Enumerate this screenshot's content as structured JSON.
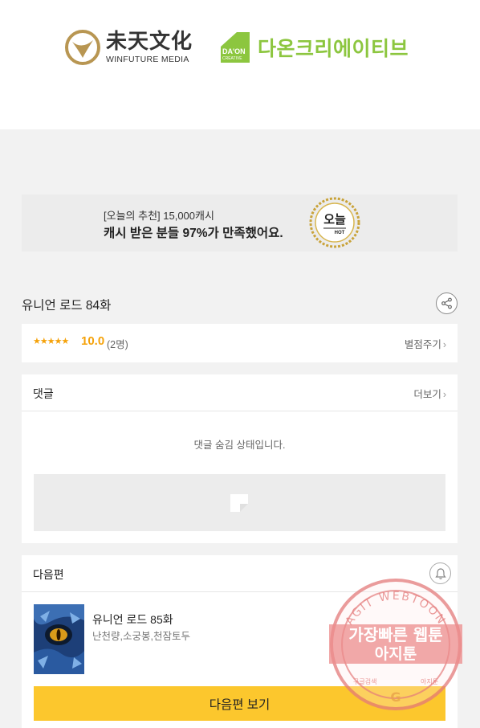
{
  "publishers": {
    "left": {
      "name_cn": "未天文化",
      "name_en": "WINFUTURE MEDIA"
    },
    "right": {
      "box_line1": "DA'ON",
      "box_line2": "CREATIVE",
      "name": "다온크리에이티브"
    }
  },
  "ad": {
    "line1": "[오늘의 추천] 15,000캐시",
    "line2": "캐시 받은 분들 97%가 만족했어요.",
    "badge_text": "오늘",
    "badge_sub": "HOT"
  },
  "episode": {
    "title": "유니언 로드 84화",
    "share_icon": "share-icon"
  },
  "rating": {
    "stars": "★★★★★",
    "score": "10.0",
    "count": "(2명)",
    "rate_label": "별점주기",
    "chevron": "›"
  },
  "comments": {
    "header": "댓글",
    "more_label": "더보기",
    "chevron": "›",
    "hidden_message": "댓글 숨김 상태입니다."
  },
  "next_episode": {
    "header": "다음편",
    "bell_icon": "bell-icon",
    "title": "유니언 로드 85화",
    "authors": "난천량,소궁봉,천잠토두",
    "button_label": "다음편 보기"
  },
  "watermark": {
    "ring_text": "AGIT WEBTOON",
    "line1": "가장빠른 웹툰",
    "line2": "아지툰",
    "bottom_left": "구글검색",
    "bottom_right": "아지툰",
    "center_mark": "G"
  },
  "colors": {
    "accent_yellow": "#fcc72d",
    "star_orange": "#f5a20a",
    "daon_green": "#8cc63f",
    "winfuture_gold": "#b89652",
    "stamp_red": "#e05050"
  }
}
